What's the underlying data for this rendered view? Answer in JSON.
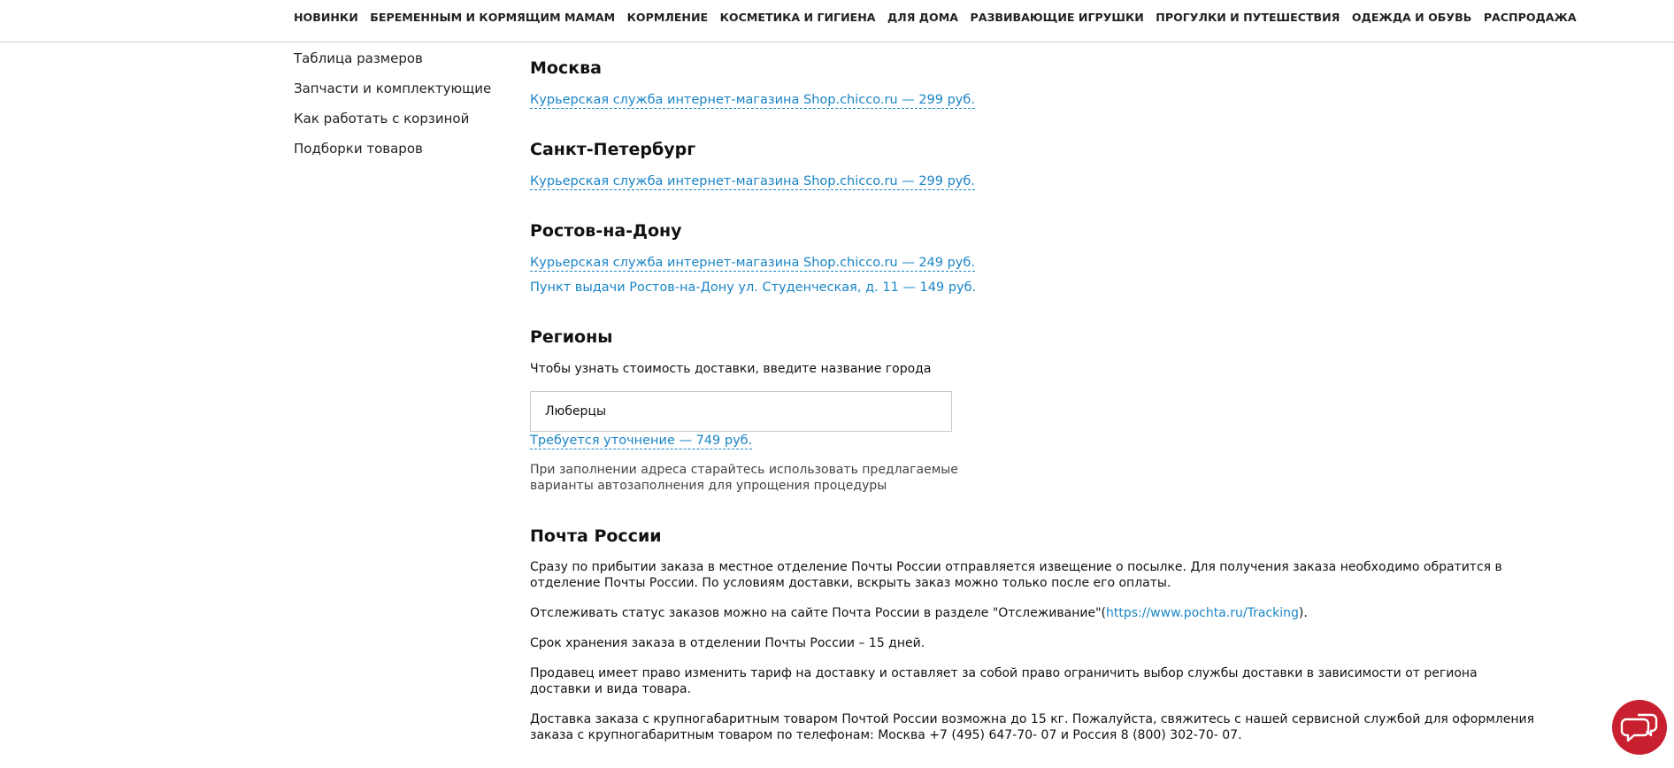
{
  "nav": {
    "items": [
      "НОВИНКИ",
      "БЕРЕМЕННЫМ И КОРМЯЩИМ МАМАМ",
      "КОРМЛЕНИЕ",
      "КОСМЕТИКА И ГИГИЕНА",
      "ДЛЯ ДОМА",
      "РАЗВИВАЮЩИЕ ИГРУШКИ",
      "ПРОГУЛКИ И ПУТЕШЕСТВИЯ",
      "ОДЕЖДА И ОБУВЬ",
      "РАСПРОДАЖА"
    ]
  },
  "sidebar": {
    "items": [
      "Таблица размеров",
      "Запчасти и комплектующие",
      "Как работать с корзиной",
      "Подборки товаров"
    ]
  },
  "moscow": {
    "title": "Москва",
    "link": "Курьерская служба интернет-магазина Shop.chicco.ru — 299 руб."
  },
  "spb": {
    "title": "Санкт-Петербург",
    "link": "Курьерская служба интернет-магазина Shop.chicco.ru — 299 руб."
  },
  "rostov": {
    "title": "Ростов-на-Дону",
    "link1": "Курьерская служба интернет-магазина Shop.chicco.ru — 249 руб.",
    "link2": "Пункт выдачи Ростов-на-Дону ул. Студенческая, д. 11 — 149 руб."
  },
  "regions": {
    "title": "Регионы",
    "hint": "Чтобы узнать стоимость доставки, введите название города",
    "city_value": "Люберцы",
    "result_link": "Требуется уточнение — 749 руб.",
    "note_line1": "При заполнении адреса старайтесь использовать предлагаемые",
    "note_line2": "варианты автозаполнения для упрощения процедуры"
  },
  "pochta": {
    "title": "Почта России",
    "p1_line1": "Сразу по прибытии заказа в местное отделение Почты России отправляется извещение о посылке. Для получения заказа необходимо обратится в",
    "p1_line2": "отделение Почты России. По условиям доставки, вскрыть заказ можно только после его оплаты.",
    "p2_before": "Отслеживать статус заказов можно на сайте Почта России в разделе \"Отслеживание\"(",
    "p2_link": "https://www.pochta.ru/Tracking",
    "p2_after": ").",
    "p3": "Срок хранения заказа в отделении Почты России – 15 дней.",
    "p4_line1": "Продавец имеет право изменить тариф на доставку и оставляет за собой право ограничить выбор службы доставки в зависимости от региона",
    "p4_line2": "доставки и вида товара.",
    "p5_line1": "Доставка заказа с крупногабаритным товаром Почтой России возможна до 15 кг. Пожалуйста, свяжитесь с нашей сервисной службой для оформления",
    "p5_line2": "заказа с крупногабаритным товаром по телефонам: Москва +7 (495) 647-70- 07 и Россия 8 (800) 302-70- 07."
  },
  "chat": {
    "icon": "chat-bubbles-icon",
    "color": "#c8202f"
  },
  "colors": {
    "link": "#1a85c6"
  }
}
